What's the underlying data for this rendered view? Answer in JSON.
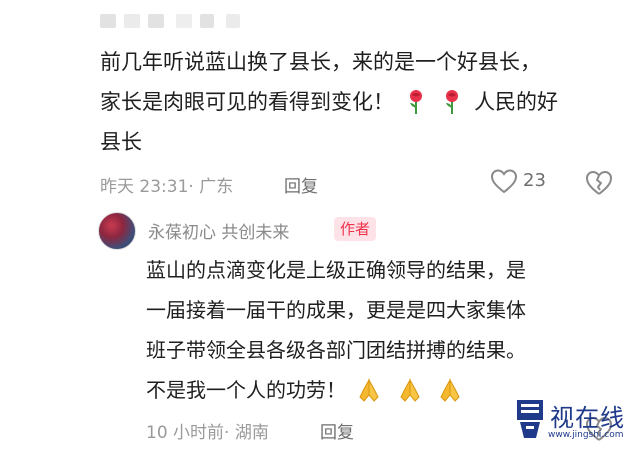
{
  "comment": {
    "text_line1": "前几年听说蓝山换了县长，来的是一个好县长，",
    "text_line2a": "家长是肉眼可见的看得到变化！",
    "text_line2b": "人民的好",
    "text_line3": "县长",
    "emoji": "rose",
    "time": "昨天 23:31",
    "location": "· 广东",
    "reply_label": "回复",
    "like_count": "23"
  },
  "reply": {
    "author": "永葆初心 共创未来",
    "badge": "作者",
    "text_line1": "蓝山的点滴变化是上级正确领导的结果，是",
    "text_line2": "一届接着一届干的成果，更是是四大家集体",
    "text_line3": "班子带领全县各级各部门团结拼搏的结果。",
    "text_line4": "不是我一个人的功劳！",
    "emoji": "folded-hands",
    "time": "10 小时前",
    "location": "· 湖南",
    "reply_label": "回复"
  },
  "watermark": {
    "name": "视在线",
    "url": "www.jingshi.com"
  },
  "colors": {
    "badge_text": "#f0324b",
    "badge_bg": "#fde3e7",
    "rose": "#e8304a",
    "hands": "#f5b82e",
    "watermark": "#1f3a8a"
  }
}
